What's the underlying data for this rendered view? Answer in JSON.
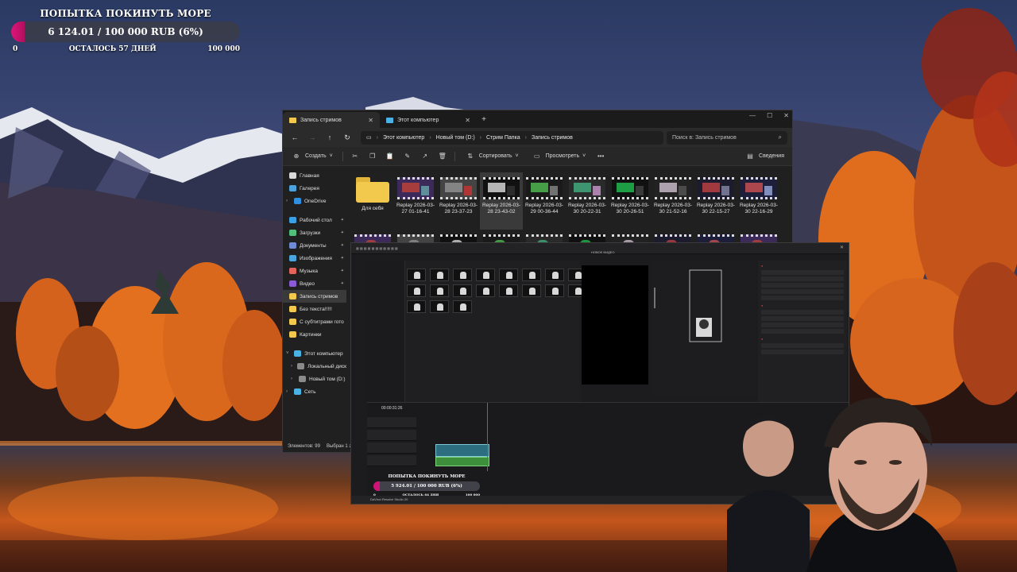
{
  "goal": {
    "title": "ПОПЫТКА ПОКИНУТЬ МОРЕ",
    "amount": "6 124.01 / 100 000 RUB (6%)",
    "progress_fraction": 0.06,
    "min": "0",
    "remaining": "ОСТАЛОСЬ 57 ДНЕЙ",
    "max": "100 000",
    "accent_color": "#e0137a"
  },
  "explorer": {
    "tabs": [
      {
        "label": "Запись стримов",
        "icon": "folder-icon",
        "active": true
      },
      {
        "label": "Этот компьютер",
        "icon": "monitor-icon",
        "active": false
      }
    ],
    "breadcrumbs": [
      "Этот компьютер",
      "Новый том (D:)",
      "Стрим Папка",
      "Запись стримов"
    ],
    "search_placeholder": "Поиск в: Запись стримов",
    "toolbar": {
      "create": "Создать",
      "sort": "Сортировать",
      "view": "Просмотреть",
      "details": "Сведения"
    },
    "nav": {
      "home": "Главная",
      "gallery": "Галерея",
      "onedrive": "OneDrive",
      "pinned": [
        {
          "label": "Рабочий стол",
          "icon": "desktop-icon",
          "color": "#3aa0e8"
        },
        {
          "label": "Загрузки",
          "icon": "download-icon",
          "color": "#4fbf7a"
        },
        {
          "label": "Документы",
          "icon": "documents-icon",
          "color": "#6f8bd8"
        },
        {
          "label": "Изображения",
          "icon": "pictures-icon",
          "color": "#49a6e0"
        },
        {
          "label": "Музыка",
          "icon": "music-icon",
          "color": "#e3625a"
        },
        {
          "label": "Видео",
          "icon": "video-icon",
          "color": "#8c5ad8"
        },
        {
          "label": "Запись стримов",
          "icon": "folder-icon",
          "color": "#f2c94c"
        },
        {
          "label": "Без текста!!!!!",
          "icon": "folder-icon",
          "color": "#f2c94c"
        },
        {
          "label": "С субтитрами гото",
          "icon": "folder-icon",
          "color": "#f2c94c"
        },
        {
          "label": "Картинки",
          "icon": "folder-icon",
          "color": "#f2c94c"
        }
      ],
      "this_pc": "Этот компьютер",
      "local_disk": "Локальный диск",
      "new_volume": "Новый том (D:)",
      "network": "Сеть"
    },
    "files_row1": [
      {
        "type": "folder",
        "name": "Для себя"
      },
      {
        "type": "video",
        "name": "Replay 2026-03-27 01-16-41"
      },
      {
        "type": "video",
        "name": "Replay 2026-03-28 23-37-23"
      },
      {
        "type": "video",
        "name": "Replay 2026-03-28 23-43-02"
      },
      {
        "type": "video",
        "name": "Replay 2026-03-29 00-36-44"
      },
      {
        "type": "video",
        "name": "Replay 2026-03-30 20-22-31"
      },
      {
        "type": "video",
        "name": "Replay 2026-03-30 20-26-51"
      },
      {
        "type": "video",
        "name": "Replay 2026-03-30 21-52-16"
      },
      {
        "type": "video",
        "name": "Replay 2026-03-30 22-15-27"
      },
      {
        "type": "video",
        "name": "Replay 2026-03-30 22-16-29"
      }
    ],
    "status": {
      "count": "Элементов: 99",
      "selected": "Выбран 1 э"
    }
  },
  "resolve": {
    "project_title": "НОВОЕ ВИДЕО",
    "timecode": "00:00:31:26",
    "footer": "DaVinci Resolve Studio 20",
    "mini_goal": {
      "title": "ПОПЫТКА ПОКИНУТЬ МОРЕ",
      "amount": "5 924.01 / 100 000 RUB (6%)",
      "remaining": "ОСТАЛОСЬ 64 ДНЯ",
      "min": "0",
      "max": "100 000"
    }
  }
}
